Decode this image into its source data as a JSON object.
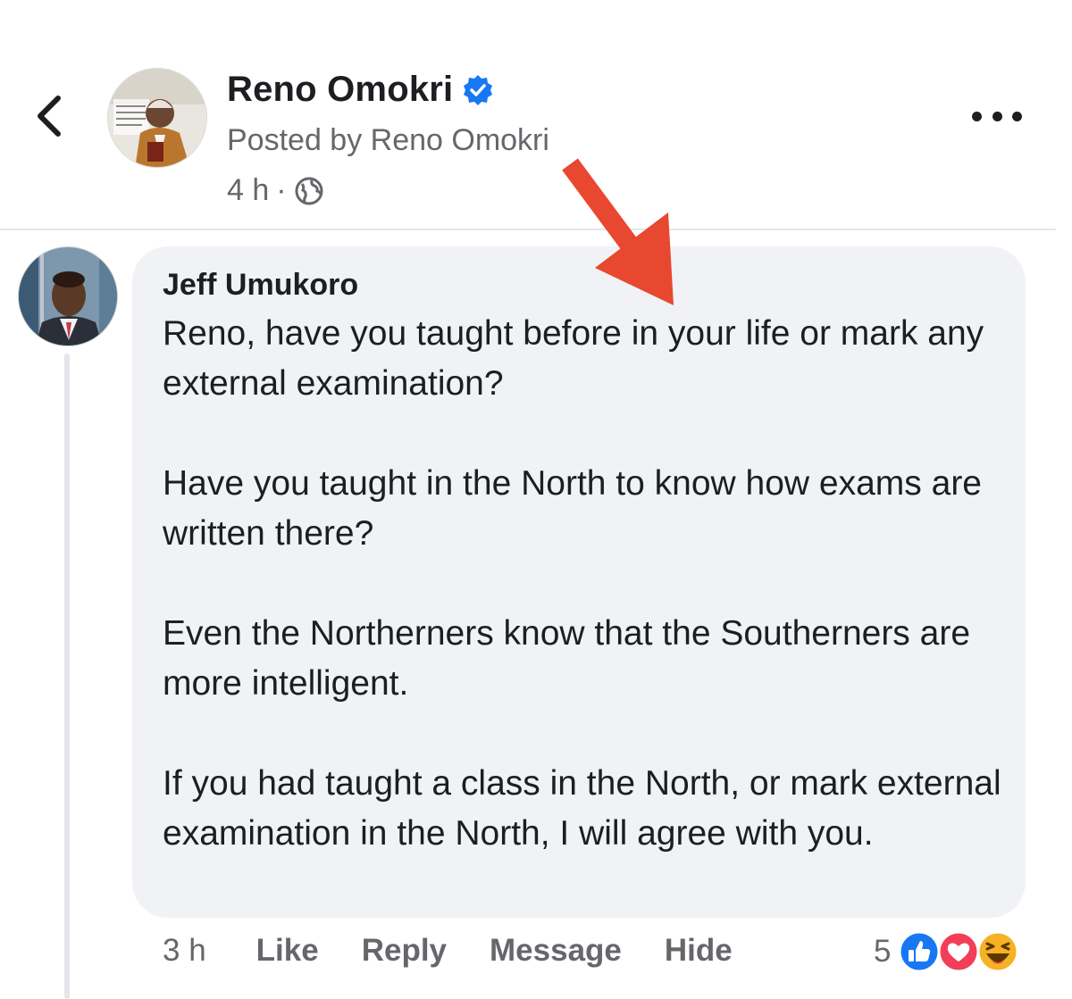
{
  "post_header": {
    "page_name": "Reno Omokri",
    "posted_by": "Posted by Reno Omokri",
    "time": "4 h",
    "separator": "·",
    "verified_icon": "verified-badge-icon",
    "privacy_icon": "globe-icon"
  },
  "comment": {
    "author": "Jeff Umukoro",
    "paragraphs": [
      "Reno, have you taught before in your life or mark any external examination?",
      "Have you taught in the North to know how exams are written there?",
      "Even the Northerners know that the Southerners are more intelligent.",
      "If you had taught a class in the North, or mark external examination in the North, I will agree with you."
    ],
    "time": "3 h",
    "actions": {
      "like": "Like",
      "reply": "Reply",
      "message": "Message",
      "hide": "Hide"
    },
    "reaction_count": "5",
    "reaction_icons": [
      "like-reaction-icon",
      "love-reaction-icon",
      "haha-reaction-icon"
    ]
  },
  "colors": {
    "accent_blue": "#1877f2",
    "bubble_bg": "#f0f2f5",
    "secondary_text": "#65676b",
    "annotation_arrow": "#e8482f",
    "love_red": "#f33e58",
    "haha_yellow": "#f7b125"
  }
}
